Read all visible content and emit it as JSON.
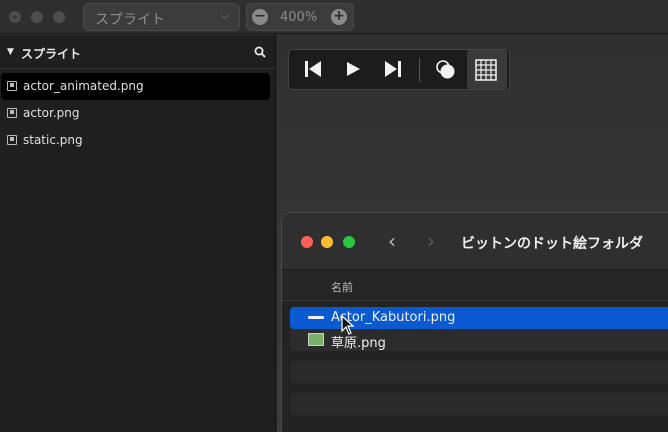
{
  "toolbar": {
    "mode_label": "スプライト",
    "zoom_value": "400%"
  },
  "sidebar": {
    "title": "スプライト",
    "items": [
      {
        "label": "actor_animated.png",
        "selected": true
      },
      {
        "label": "actor.png",
        "selected": false
      },
      {
        "label": "static.png",
        "selected": false
      }
    ]
  },
  "playback": {
    "buttons": [
      "first-frame",
      "play",
      "last-frame",
      "onion-skin",
      "grid"
    ]
  },
  "finder": {
    "title": "ビットンのドット絵フォルダ",
    "column_name": "名前",
    "files": [
      {
        "name": "Actor_Kabutori.png",
        "selected": true
      },
      {
        "name": "草原.png",
        "selected": false
      }
    ]
  },
  "colors": {
    "selection_blue": "#0a5ad1",
    "close_red": "#fe5f57",
    "minimize_yellow": "#febc2e",
    "zoom_green": "#28c840"
  }
}
